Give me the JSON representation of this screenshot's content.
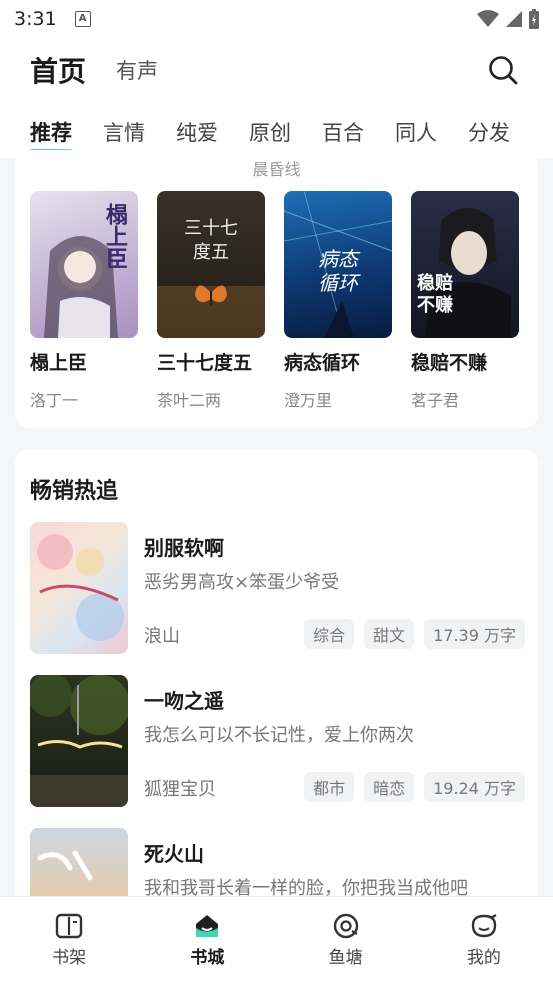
{
  "status": {
    "time": "3:31"
  },
  "header": {
    "title": "首页",
    "subtitle": "有声"
  },
  "tabs": [
    {
      "label": "推荐",
      "active": true
    },
    {
      "label": "言情"
    },
    {
      "label": "纯爱"
    },
    {
      "label": "原创"
    },
    {
      "label": "百合"
    },
    {
      "label": "同人"
    },
    {
      "label": "分发"
    }
  ],
  "top_section": {
    "cutoff_text": "晨昏线",
    "books": [
      {
        "title": "榻上臣",
        "author": "洛丁一",
        "cover_text": "榻上臣"
      },
      {
        "title": "三十七度五",
        "author": "茶叶二两",
        "cover_text": "三十七\n度五"
      },
      {
        "title": "病态循环",
        "author": "澄万里",
        "cover_text": "病态循环"
      },
      {
        "title": "稳赔不赚",
        "author": "茗子君",
        "cover_text": "稳赔不赚"
      }
    ]
  },
  "hot_section": {
    "title": "畅销热追",
    "items": [
      {
        "title": "别服软啊",
        "desc": "恶劣男高攻×笨蛋少爷受",
        "author": "浪山",
        "tags": [
          "综合",
          "甜文",
          "17.39 万字"
        ]
      },
      {
        "title": "一吻之遥",
        "desc": "我怎么可以不长记性，爱上你两次",
        "author": "狐狸宝贝",
        "tags": [
          "都市",
          "暗恋",
          "19.24 万字"
        ]
      },
      {
        "title": "死火山",
        "desc": "我和我哥长着一样的脸，你把我当成他吧",
        "author": "",
        "tags": []
      }
    ]
  },
  "bottom_nav": [
    {
      "label": "书架",
      "icon": "bookshelf-icon"
    },
    {
      "label": "书城",
      "icon": "bookstore-icon",
      "active": true
    },
    {
      "label": "鱼塘",
      "icon": "fishpond-icon"
    },
    {
      "label": "我的",
      "icon": "profile-icon"
    }
  ],
  "accent": "#3fd6b8"
}
